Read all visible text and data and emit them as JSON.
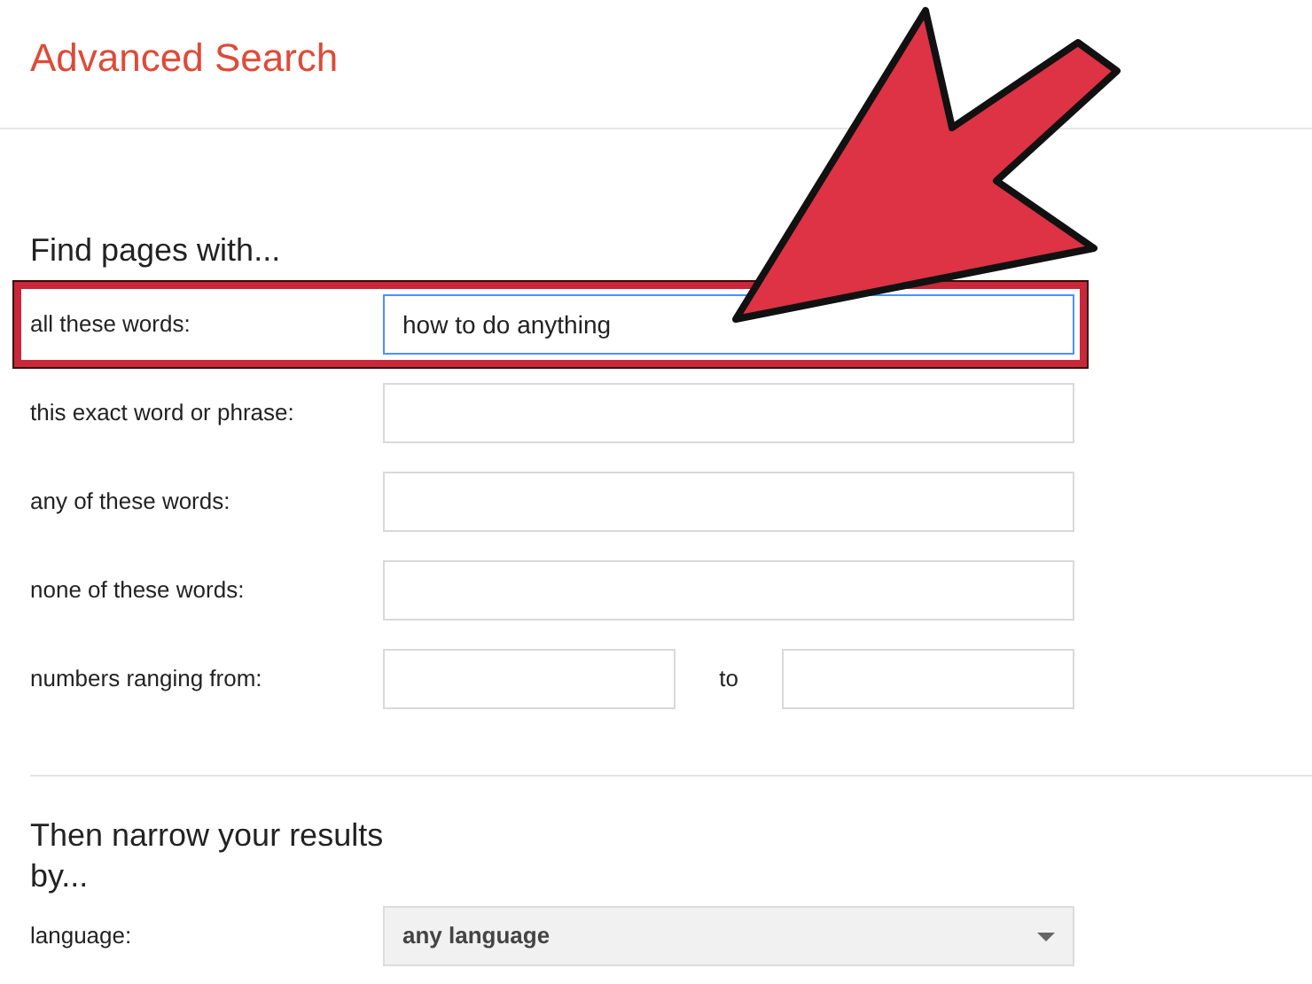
{
  "page_title": "Advanced Search",
  "find_section": {
    "heading": "Find pages with...",
    "rows": [
      {
        "kind": "text",
        "label": "all these words:",
        "value": "how to do anything",
        "highlighted": true,
        "focused": true
      },
      {
        "kind": "text",
        "label": "this exact word or phrase:",
        "highlighted": false,
        "focused": false
      },
      {
        "kind": "text",
        "label": "any of these words:",
        "highlighted": false,
        "focused": false
      },
      {
        "kind": "text",
        "label": "none of these words:",
        "highlighted": false,
        "focused": false
      },
      {
        "kind": "range",
        "label": "numbers ranging from:",
        "separator": "to",
        "highlighted": false,
        "focused": false
      }
    ]
  },
  "narrow_section": {
    "heading": "Then narrow your results by...",
    "rows": [
      {
        "kind": "select",
        "label": "language:",
        "value": "any language"
      }
    ]
  }
}
